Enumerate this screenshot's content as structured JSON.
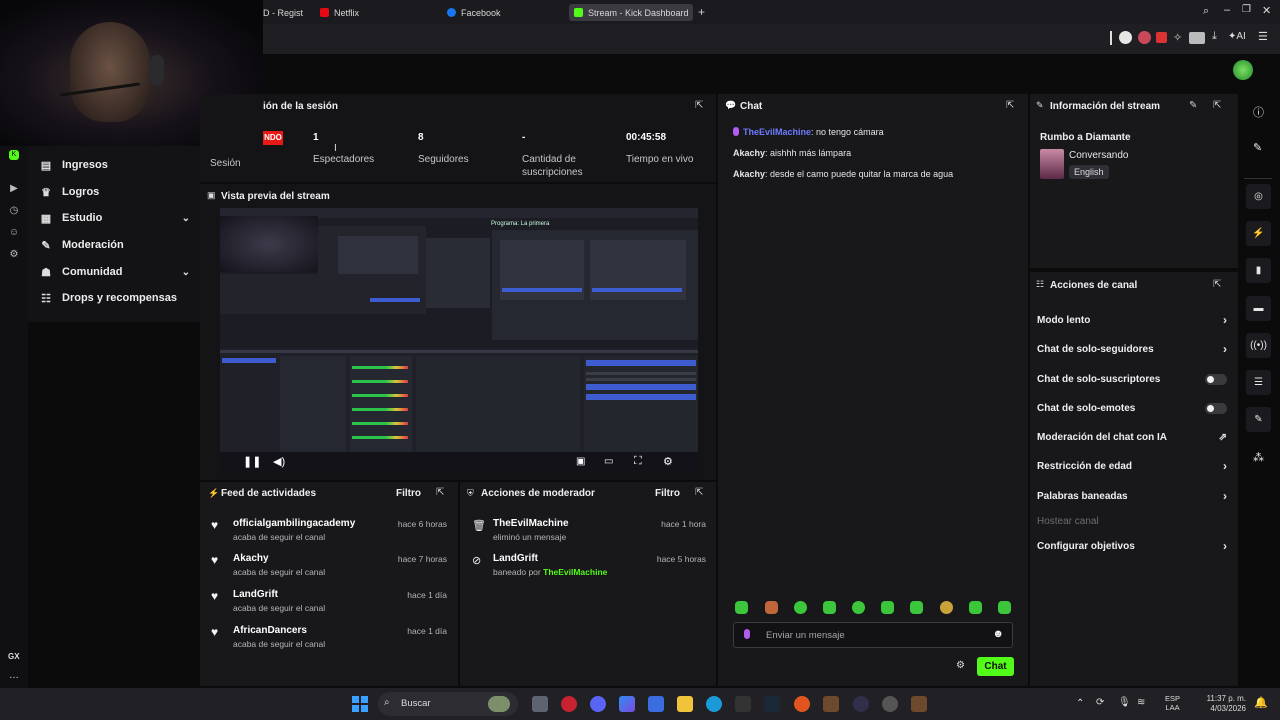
{
  "browser": {
    "tabs": [
      {
        "label": "D - Regist",
        "active": false,
        "favicon_color": "#7b7b7b"
      },
      {
        "label": "Netflix",
        "active": false,
        "favicon_color": "#e50914"
      },
      {
        "label": "Facebook",
        "active": false,
        "favicon_color": "#1877f2"
      },
      {
        "label": "Stream - Kick Dashboard",
        "active": true,
        "favicon_color": "#53fc18"
      }
    ],
    "new_tab": "+",
    "ai_label": "AI"
  },
  "nav": {
    "items": [
      {
        "label": "Ingresos",
        "icon": "bar-chart-icon",
        "glyph": "▤",
        "expandable": false
      },
      {
        "label": "Logros",
        "icon": "trophy-icon",
        "glyph": "♛",
        "expandable": false
      },
      {
        "label": "Estudio",
        "icon": "studio-icon",
        "glyph": "▦",
        "expandable": true
      },
      {
        "label": "Moderación",
        "icon": "wrench-icon",
        "glyph": "✎",
        "expandable": false
      },
      {
        "label": "Comunidad",
        "icon": "community-icon",
        "glyph": "☗",
        "expandable": true
      },
      {
        "label": "Drops y recompensas",
        "icon": "drops-icon",
        "glyph": "☷",
        "expandable": false
      }
    ],
    "rail_bottom": "GX"
  },
  "session": {
    "title": "ión de la sesión",
    "live_badge": "NDO",
    "session_label": "Sesión",
    "stats": [
      {
        "value": "1",
        "label": "Espectadores"
      },
      {
        "value": "8",
        "label": "Seguidores"
      },
      {
        "value": "-",
        "label": "Cantidad de suscripciones"
      },
      {
        "value": "00:45:58",
        "label": "Tiempo en vivo"
      }
    ]
  },
  "preview": {
    "title": "Vista previa del stream",
    "program_label": "Programa: La primera"
  },
  "activity_feed": {
    "title": "Feed de actividades",
    "filter": "Filtro",
    "items": [
      {
        "name": "officialgambilingacademy",
        "sub": "acaba de seguir el canal",
        "time": "hace 6 horas"
      },
      {
        "name": "Akachy",
        "sub": "acaba de seguir el canal",
        "time": "hace 7 horas"
      },
      {
        "name": "LandGrift",
        "sub": "acaba de seguir el canal",
        "time": "hace 1 día"
      },
      {
        "name": "AfricanDancers",
        "sub": "acaba de seguir el canal",
        "time": "hace 1 día"
      }
    ]
  },
  "mod_actions": {
    "title": "Acciones de moderador",
    "filter": "Filtro",
    "items": [
      {
        "name": "TheEvilMachine",
        "sub": "eliminó un mensaje",
        "time": "hace 1 hora",
        "icon": "trash-icon"
      },
      {
        "name": "LandGrift",
        "sub_prefix": "baneado por",
        "sub_user": "TheEvilMachine",
        "time": "hace 5 horas",
        "icon": "ban-icon"
      }
    ]
  },
  "chat": {
    "title": "Chat",
    "messages": [
      {
        "user": "TheEvilMachine",
        "text": ": no tengo cámara",
        "user_color": "#6e7bff"
      },
      {
        "user": "Akachy",
        "text": ": aishhh más lámpara",
        "user_color": "#e6e6e6"
      },
      {
        "user": "Akachy",
        "text": ": desde el camo puede quitar la marca de agua",
        "user_color": "#e6e6e6"
      }
    ],
    "placeholder": "Enviar un mensaje",
    "send_label": "Chat"
  },
  "stream_info": {
    "title": "Información del stream",
    "stream_title": "Rumbo a Diamante",
    "category": "Conversando",
    "language": "English"
  },
  "channel_actions": {
    "title": "Acciones de canal",
    "rows": [
      {
        "label": "Modo lento",
        "control": "chevron"
      },
      {
        "label": "Chat de solo-seguidores",
        "control": "chevron"
      },
      {
        "label": "Chat de solo-suscriptores",
        "control": "toggle"
      },
      {
        "label": "Chat de solo-emotes",
        "control": "toggle"
      },
      {
        "label": "Moderación del chat con IA",
        "control": "external"
      },
      {
        "label": "Restricción de edad",
        "control": "chevron"
      },
      {
        "label": "Palabras baneadas",
        "control": "chevron"
      },
      {
        "label": "Hostear canal",
        "control": "none",
        "disabled": true
      },
      {
        "label": "Configurar objetivos",
        "control": "chevron"
      }
    ]
  },
  "taskbar": {
    "search": "Buscar",
    "lang": "ESP",
    "lang2": "LAA",
    "time": "11:37 p. m.",
    "date": "4/03/2026"
  },
  "colors": {
    "accent": "#53fc18",
    "panel": "#18181b",
    "background": "#0b0b0c"
  }
}
